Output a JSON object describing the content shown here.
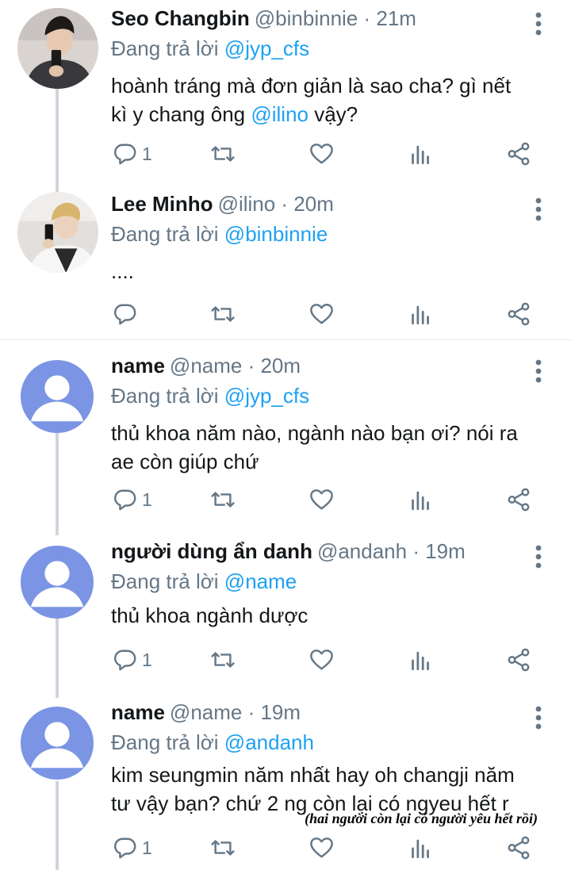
{
  "tweets": [
    {
      "name": "Seo Changbin",
      "handle_time": "@binbinnie · 21m",
      "reply_prefix": "Đang trả lời",
      "reply_to": "@jyp_cfs",
      "text_parts": [
        "hoành tráng mà đơn giản là sao cha? gì nết",
        "kì y chang ông ",
        "@ilino",
        " vậy?"
      ],
      "reply_count": "1",
      "avatar": "photo"
    },
    {
      "name": "Lee Minho",
      "handle_time": "@ilino · 20m",
      "reply_prefix": "Đang trả lời",
      "reply_to": "@binbinnie",
      "text": "....",
      "reply_count": "",
      "avatar": "photo"
    },
    {
      "name": "name",
      "handle_time": "@name · 20m",
      "reply_prefix": "Đang trả lời",
      "reply_to": "@jyp_cfs",
      "text_lines": [
        "thủ khoa năm nào, ngành nào bạn ơi? nói ra",
        "ae còn giúp chứ"
      ],
      "reply_count": "1",
      "avatar": "default"
    },
    {
      "name": "người dùng ẩn danh",
      "handle_time": "@andanh · 19m",
      "reply_prefix": "Đang trả lời",
      "reply_to": "@name",
      "text": "thủ khoa ngành dược",
      "reply_count": "1",
      "avatar": "default"
    },
    {
      "name": "name",
      "handle_time": "@name · 19m",
      "reply_prefix": "Đang trả lời",
      "reply_to": "@andanh",
      "text_lines": [
        "kim seungmin năm nhất hay oh changji năm",
        "tư vậy bạn? chứ 2 ng còn lại có ngyeu hết r"
      ],
      "reply_count": "1",
      "avatar": "default"
    }
  ],
  "annotation": "(hai người còn lại có người yêu hết rồi)",
  "icons": {
    "reply": "reply-icon",
    "retweet": "retweet-icon",
    "like": "heart-icon",
    "analytics": "analytics-icon",
    "share": "share-icon",
    "more": "more-vertical-icon"
  },
  "colors": {
    "mention": "#1da1f2",
    "secondary_text": "#657786",
    "default_avatar_bg": "#7b95e4",
    "divider": "#e1e8ed"
  }
}
